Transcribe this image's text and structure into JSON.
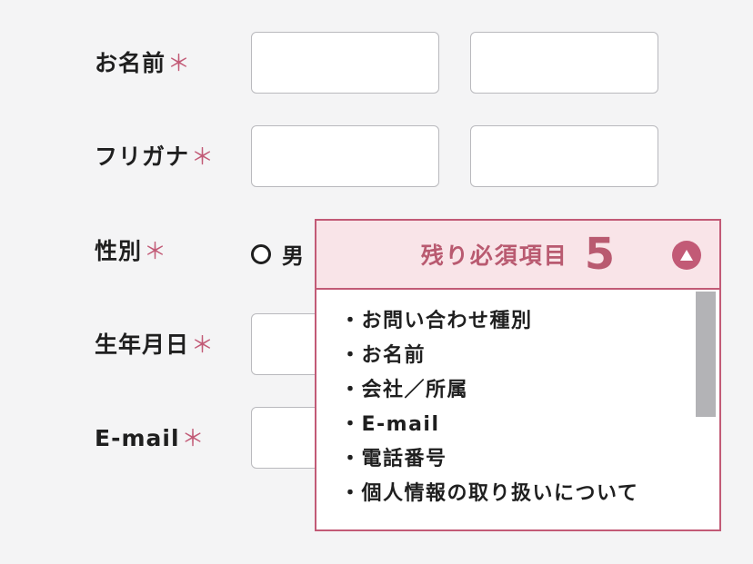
{
  "form": {
    "required_mark": "＊",
    "rows": [
      {
        "label": "お名前"
      },
      {
        "label": "フリガナ"
      },
      {
        "label": "性別"
      },
      {
        "label": "生年月日"
      },
      {
        "label": "E-mail"
      }
    ],
    "gender_option_label": "男"
  },
  "panel": {
    "title": "残り必須項目",
    "count": "5",
    "toggle_icon": "triangle-up-icon",
    "items": [
      "・お問い合わせ種別",
      "・お名前",
      "・会社／所属",
      "・E-mail",
      "・電話番号",
      "・個人情報の取り扱いについて"
    ]
  },
  "colors": {
    "accent": "#c25a76",
    "panel_header_bg": "#f9e4e8",
    "page_bg": "#f4f4f5"
  }
}
